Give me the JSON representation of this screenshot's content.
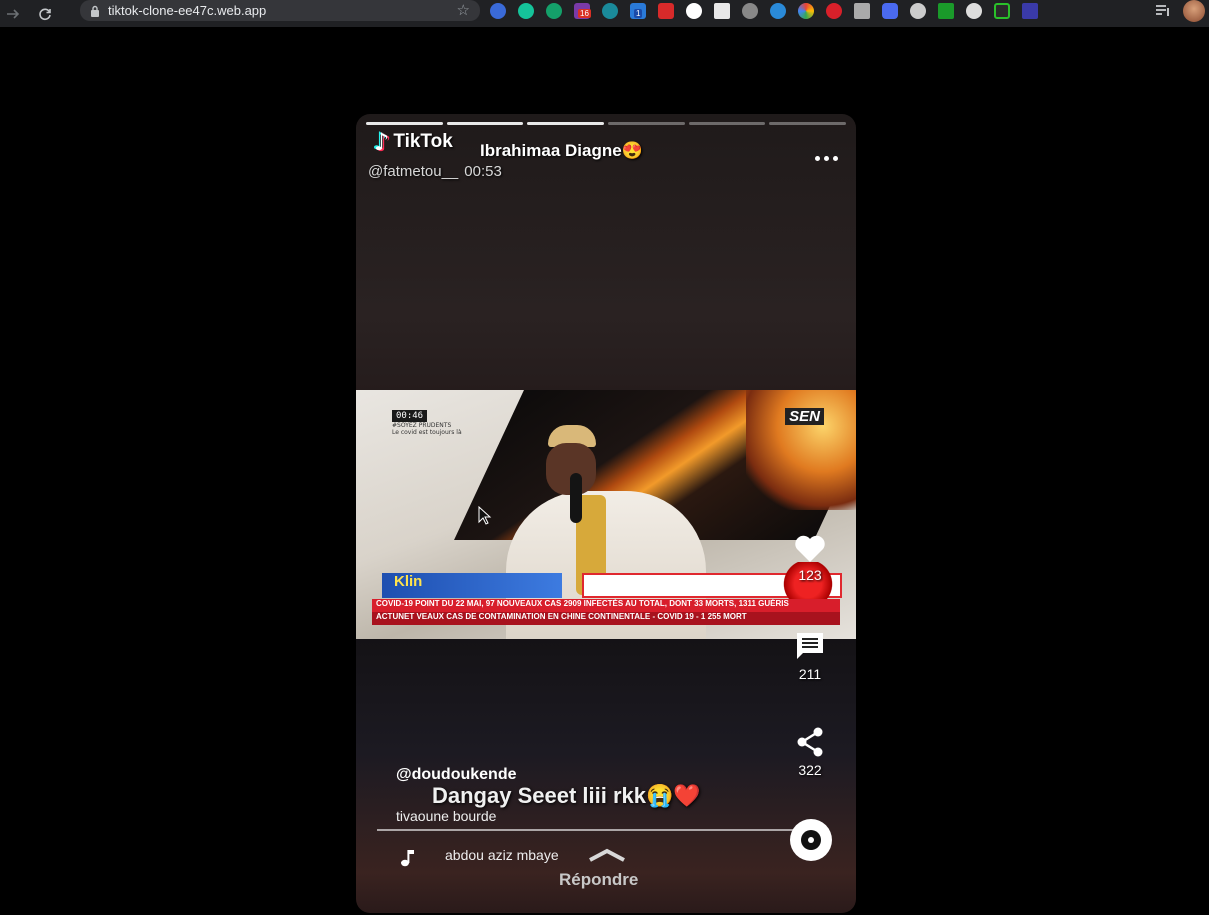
{
  "browser": {
    "url": "tiktok-clone-ee47c.web.app",
    "extension_badges": [
      "16",
      "1"
    ]
  },
  "story": {
    "progress": [
      1,
      1,
      1,
      0,
      0,
      0
    ],
    "logo_text": "TikTok",
    "overlay_title": "Ibrahimaa Diagne😍",
    "overlay_handle": "@fatmetou__",
    "overlay_time": "00:53"
  },
  "video": {
    "timer": "00:46",
    "sub_timer": "#SOYEZ PRUDENTS",
    "sub_timer2": "Le covid est toujours là",
    "channel": "SEN",
    "ticker_brand": "Klin",
    "ticker_line1": "COVID-19  POINT DU 22 MAI, 97 NOUVEAUX CAS  2909  INFECTÉS AU TOTAL, DONT 33 MORTS, 1311 GUÉRIS",
    "ticker_line2": "ACTUNET  VEAUX CAS DE CONTAMINATION EN CHINE CONTINENTALE  -  COVID 19 - 1 255 MORT"
  },
  "actions": {
    "likes": "123",
    "comments": "211",
    "shares": "322"
  },
  "post": {
    "username": "@doudoukende",
    "overlay_caption": "Dangay Seeet liii rkk😭❤️",
    "description": "tivaoune bourde",
    "song": "abdou aziz mbaye",
    "reply_label": "Répondre"
  },
  "colors": {
    "like": "#ffffff",
    "ticker_red": "#d81e2b",
    "ticker_blue": "#1e4fb0"
  }
}
